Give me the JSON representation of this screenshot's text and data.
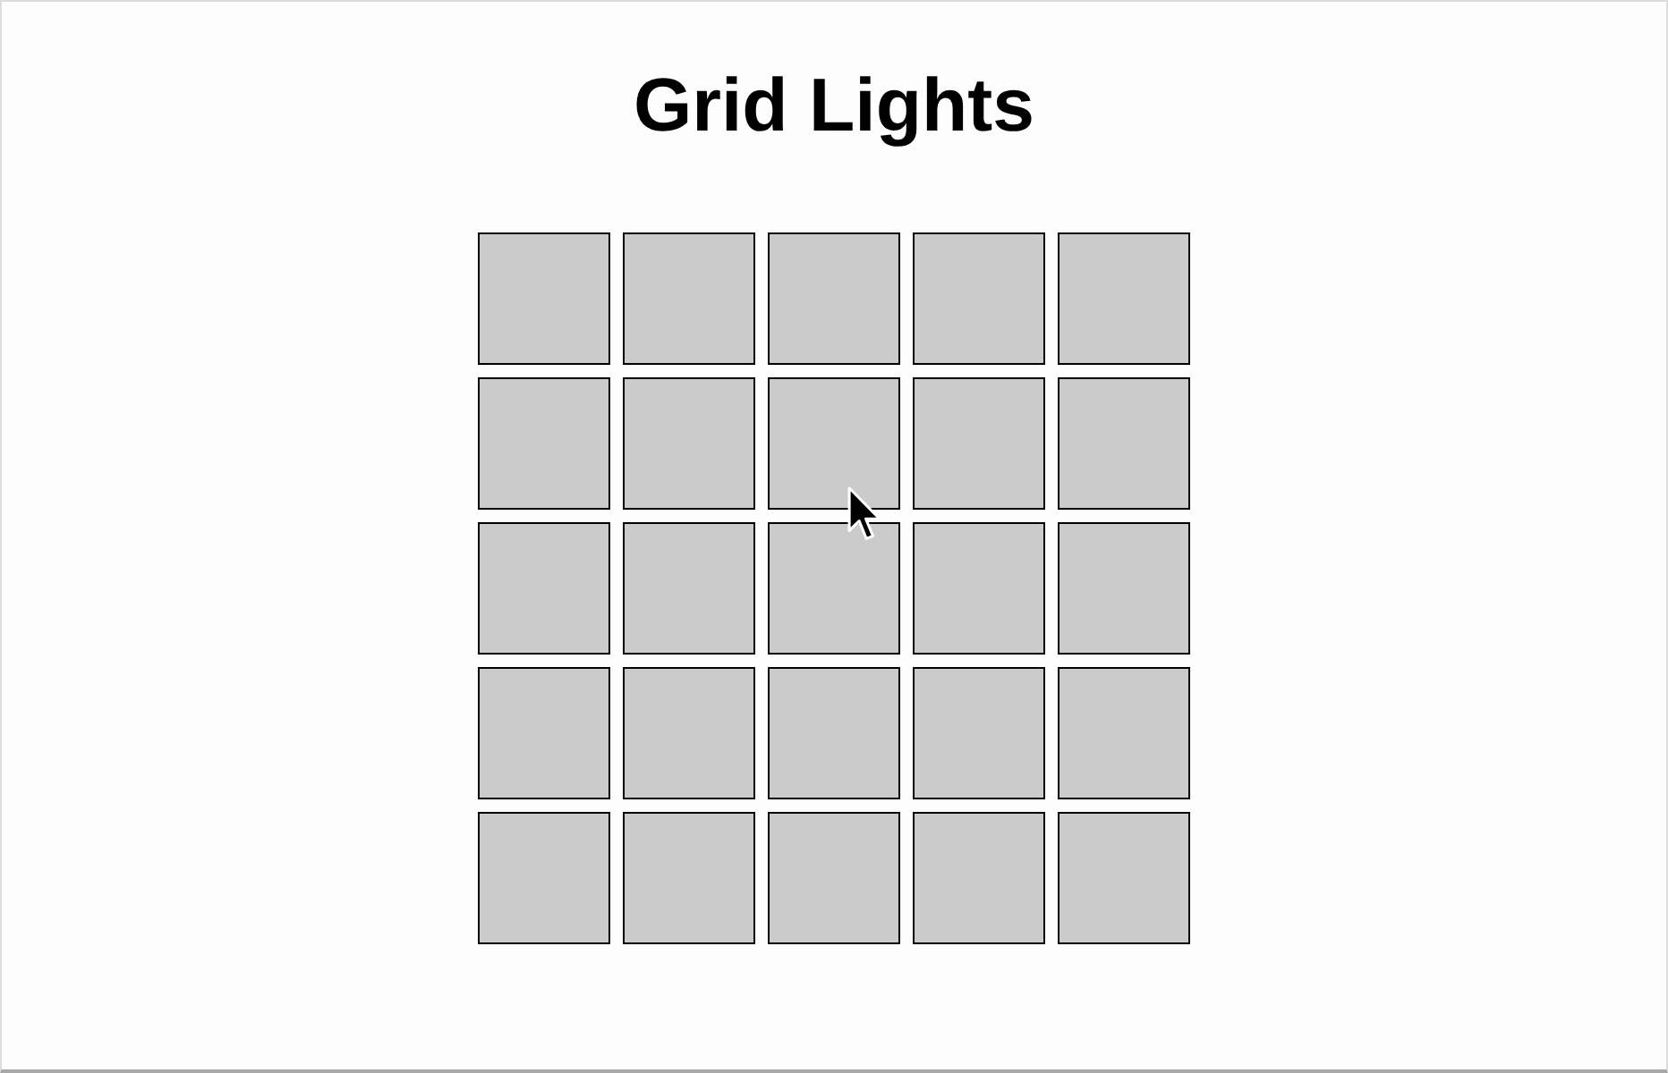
{
  "page": {
    "title": "Grid Lights"
  },
  "grid": {
    "rows": [
      {
        "cells": [
          {
            "lit": false
          },
          {
            "lit": false
          },
          {
            "lit": false
          },
          {
            "lit": false
          },
          {
            "lit": false
          }
        ]
      },
      {
        "cells": [
          {
            "lit": false
          },
          {
            "lit": false
          },
          {
            "lit": false
          },
          {
            "lit": false
          },
          {
            "lit": false
          }
        ]
      },
      {
        "cells": [
          {
            "lit": false
          },
          {
            "lit": false
          },
          {
            "lit": false
          },
          {
            "lit": false
          },
          {
            "lit": false
          }
        ]
      },
      {
        "cells": [
          {
            "lit": false
          },
          {
            "lit": false
          },
          {
            "lit": false
          },
          {
            "lit": false
          },
          {
            "lit": false
          }
        ]
      },
      {
        "cells": [
          {
            "lit": false
          },
          {
            "lit": false
          },
          {
            "lit": false
          },
          {
            "lit": false
          },
          {
            "lit": false
          }
        ]
      }
    ]
  }
}
